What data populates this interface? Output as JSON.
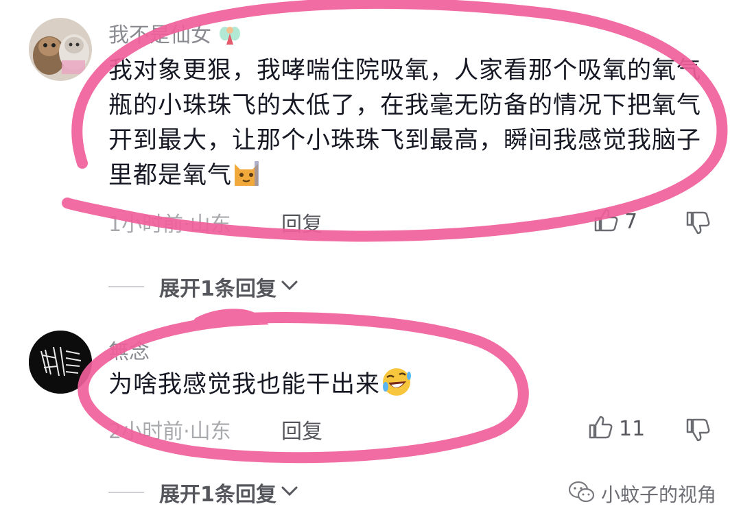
{
  "comments": [
    {
      "username": "我不是仙女",
      "username_emoji": "fairy",
      "text": "我对象更狠，我哮喘住院吸氧，人家看那个吸氧的氧气瓶的小珠珠飞的太低了，在我毫无防备的情况下把氧气开到最大，让那个小珠珠飞到最高，瞬间我感觉我脑子里都是氧气",
      "text_emoji": "cat-emoji",
      "meta": "1小时前·山东",
      "reply_label": "回复",
      "likes": "7",
      "expand_label": "展开1条回复"
    },
    {
      "username": "無念",
      "text": "为啥我感觉我也能干出来",
      "text_emoji": "rolling-laughing-emoji",
      "meta": "2小时前·山东",
      "reply_label": "回复",
      "likes": "11",
      "expand_label": "展开1条回复"
    }
  ],
  "watermark": {
    "text": "小蚊子的视角",
    "icon": "wechat-icon"
  },
  "colors": {
    "annotation": "#f0609a",
    "text": "#161823",
    "muted": "#a8a9ad"
  }
}
